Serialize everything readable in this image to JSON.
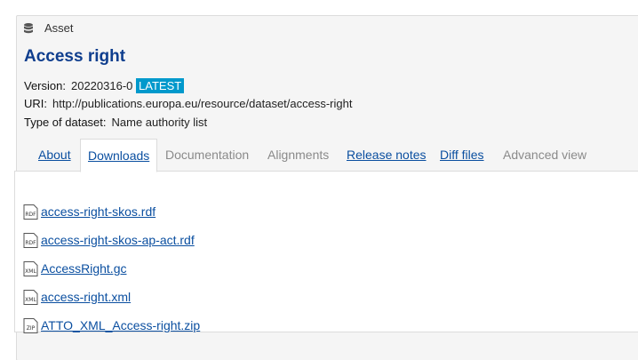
{
  "header": {
    "asset_label": "Asset",
    "title": "Access right"
  },
  "meta": {
    "version_key": "Version:",
    "version_value": "20220316-0",
    "version_badge": "LATEST",
    "uri_key": "URI:",
    "uri_value": "http://publications.europa.eu/resource/dataset/access-right",
    "type_key": "Type of dataset:",
    "type_value": "Name authority list"
  },
  "tabs": [
    {
      "label": "About",
      "state": "link"
    },
    {
      "label": "Downloads",
      "state": "active"
    },
    {
      "label": "Documentation",
      "state": "disabled"
    },
    {
      "label": "Alignments",
      "state": "disabled"
    },
    {
      "label": "Release notes",
      "state": "link"
    },
    {
      "label": "Diff files",
      "state": "link"
    },
    {
      "label": "Advanced view",
      "state": "disabled"
    }
  ],
  "files": [
    {
      "name": "access-right-skos.rdf",
      "icon": "RDF"
    },
    {
      "name": "access-right-skos-ap-act.rdf",
      "icon": "RDF"
    },
    {
      "name": "AccessRight.gc",
      "icon": "XML"
    },
    {
      "name": "access-right.xml",
      "icon": "XML"
    },
    {
      "name": "ATTO_XML_Access-right.zip",
      "icon": "ZIP"
    }
  ],
  "colors": {
    "link": "#0b4fa0",
    "title": "#0f3e8e",
    "badge": "#0099cc",
    "muted": "#8a8a8a"
  }
}
